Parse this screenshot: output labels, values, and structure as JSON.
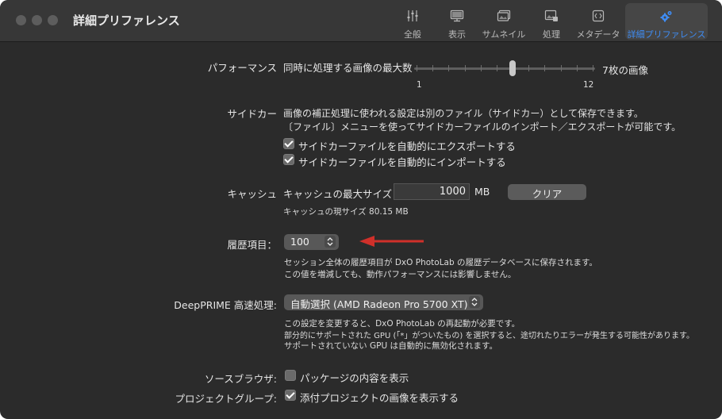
{
  "window": {
    "title": "詳細プリファレンス"
  },
  "toolbar": {
    "tabs": [
      {
        "label": "全般",
        "icon": "sliders-icon"
      },
      {
        "label": "表示",
        "icon": "monitor-icon"
      },
      {
        "label": "サムネイル",
        "icon": "thumbnails-icon"
      },
      {
        "label": "処理",
        "icon": "image-process-icon"
      },
      {
        "label": "メタデータ",
        "icon": "code-icon"
      },
      {
        "label": "詳細プリファレンス",
        "icon": "gears-icon",
        "active": true
      }
    ]
  },
  "performance": {
    "label": "パフォーマンス",
    "description": "同時に処理する画像の最大数",
    "slider_min": "1",
    "slider_max": "12",
    "slider_value": 7,
    "value_text": "7枚の画像"
  },
  "sidecar": {
    "label": "サイドカー",
    "line1": "画像の補正処理に使われる設定は別のファイル（サイドカー）として保存できます。",
    "line2": "〔ファイル〕メニューを使ってサイドカーファイルのインポート／エクスポートが可能です。",
    "export_label": "サイドカーファイルを自動的にエクスポートする",
    "export_checked": true,
    "import_label": "サイドカーファイルを自動的にインポートする",
    "import_checked": true
  },
  "cache": {
    "label": "キャッシュ",
    "max_label": "キャッシュの最大サイズ",
    "max_value": "1000",
    "unit": "MB",
    "clear_button": "クリア",
    "current": "キャッシュの現サイズ 80.15 MB"
  },
  "history": {
    "label": "履歴項目：",
    "value": "100",
    "note1": "セッション全体の履歴項目が DxO PhotoLab の履歴データベースに保存されます。",
    "note2": "この値を増減しても、動作パフォーマンスには影響しません。"
  },
  "deepprime": {
    "label": "DeepPRIME 高速処理:",
    "selected": "自動選択 (AMD Radeon Pro 5700 XT)",
    "note1": "この設定を変更すると、DxO PhotoLab の再起動が必要です。",
    "note2": "部分的にサポートされた GPU (「*」がついたもの) を選択すると、途切れたりエラーが発生する可能性があります。",
    "note3": "サポートされていない GPU は自動的に無効化されます。"
  },
  "source_browser": {
    "label": "ソースブラウザ:",
    "option": "パッケージの内容を表示",
    "checked": false
  },
  "project_group": {
    "label": "プロジェクトグループ:",
    "option": "添付プロジェクトの画像を表示する",
    "checked": true
  },
  "colors": {
    "accent": "#3f8df5",
    "arrow": "#d0302a",
    "background": "#2b2b2b"
  }
}
